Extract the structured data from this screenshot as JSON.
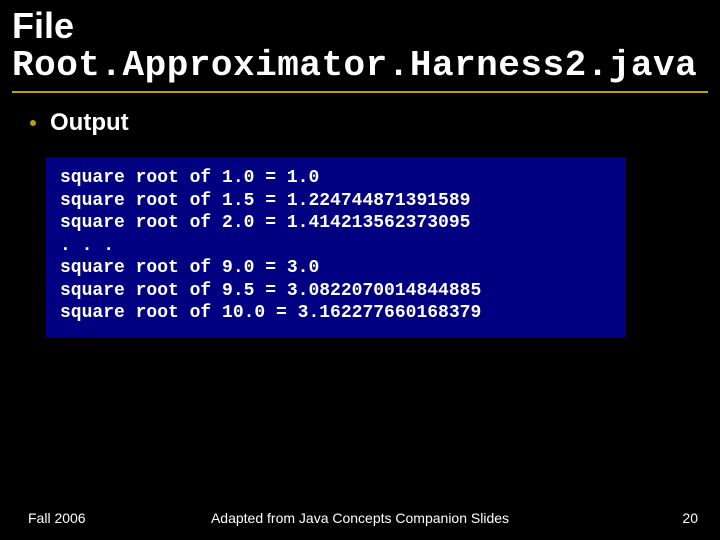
{
  "header": {
    "line1": "File",
    "line2": "Root.Approximator.Harness2.java"
  },
  "bullet": {
    "label": "Output"
  },
  "code": {
    "lines": [
      "square root of 1.0 = 1.0",
      "square root of 1.5 = 1.224744871391589",
      "square root of 2.0 = 1.414213562373095",
      ". . .",
      "square root of 9.0 = 3.0",
      "square root of 9.5 = 3.0822070014844885",
      "square root of 10.0 = 3.162277660168379"
    ]
  },
  "footer": {
    "left": "Fall 2006",
    "center": "Adapted from Java Concepts Companion Slides",
    "right": "20"
  }
}
